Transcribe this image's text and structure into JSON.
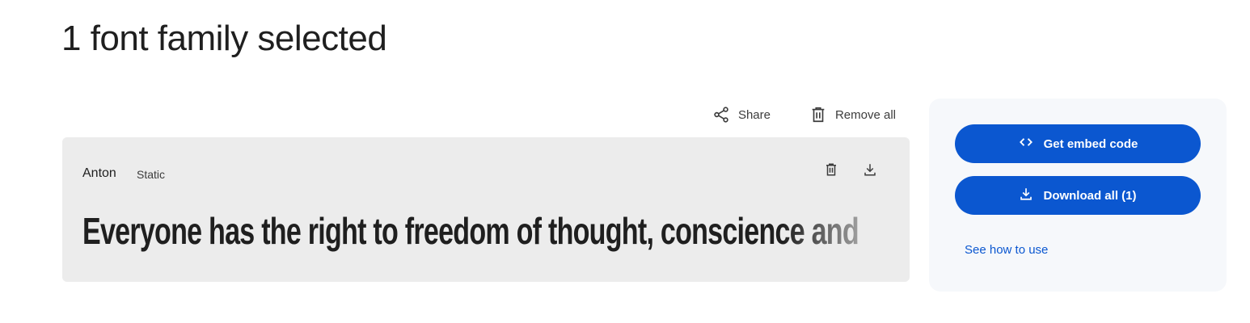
{
  "header": {
    "title": "1 font family selected"
  },
  "toolbar": {
    "share_label": "Share",
    "remove_all_label": "Remove all"
  },
  "font_card": {
    "family": "Anton",
    "style": "Static",
    "preview_text": "Everyone has the right to freedom of thought, conscience and"
  },
  "side_panel": {
    "embed_label": "Get embed code",
    "download_label": "Download all (1)",
    "how_to_label": "See how to use"
  },
  "colors": {
    "accent": "#0b57d0",
    "card_bg": "#ececec",
    "panel_bg": "#f6f8fb"
  },
  "icons": [
    "share-icon",
    "trash-icon",
    "download-icon",
    "code-icon"
  ]
}
